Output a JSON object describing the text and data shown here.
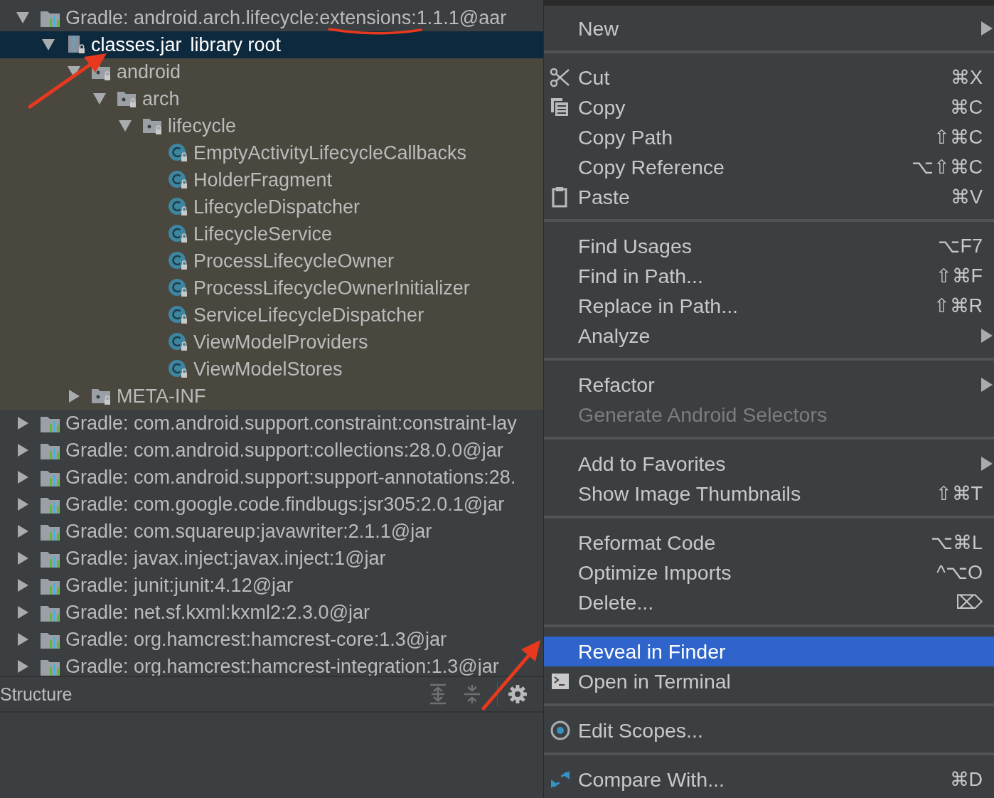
{
  "project_tree": {
    "nodes": [
      {
        "kind": "library",
        "label": "Gradle: android.arch.lifecycle:extensions:1.1.1@aar",
        "expanded": true,
        "selected": false,
        "children": [
          {
            "kind": "jar",
            "label": "classes.jar",
            "note": "library root",
            "expanded": true,
            "selected": true,
            "children": [
              {
                "kind": "package",
                "label": "android",
                "expanded": true,
                "selected": false,
                "children": [
                  {
                    "kind": "package",
                    "label": "arch",
                    "expanded": true,
                    "selected": false,
                    "children": [
                      {
                        "kind": "package",
                        "label": "lifecycle",
                        "expanded": true,
                        "selected": false,
                        "children": [
                          {
                            "kind": "class",
                            "label": "EmptyActivityLifecycleCallbacks",
                            "selected": false
                          },
                          {
                            "kind": "class",
                            "label": "HolderFragment",
                            "selected": false
                          },
                          {
                            "kind": "class",
                            "label": "LifecycleDispatcher",
                            "selected": false
                          },
                          {
                            "kind": "class",
                            "label": "LifecycleService",
                            "selected": false
                          },
                          {
                            "kind": "class",
                            "label": "ProcessLifecycleOwner",
                            "selected": false
                          },
                          {
                            "kind": "class",
                            "label": "ProcessLifecycleOwnerInitializer",
                            "selected": false
                          },
                          {
                            "kind": "class",
                            "label": "ServiceLifecycleDispatcher",
                            "selected": false
                          },
                          {
                            "kind": "class",
                            "label": "ViewModelProviders",
                            "selected": false
                          },
                          {
                            "kind": "class",
                            "label": "ViewModelStores",
                            "selected": false
                          }
                        ]
                      }
                    ]
                  }
                ]
              },
              {
                "kind": "package",
                "label": "META-INF",
                "expanded": false,
                "selected": false
              }
            ]
          }
        ]
      },
      {
        "kind": "library",
        "label": "Gradle: com.android.support.constraint:constraint-lay",
        "expanded": false,
        "selected": false
      },
      {
        "kind": "library",
        "label": "Gradle: com.android.support:collections:28.0.0@jar",
        "expanded": false,
        "selected": false
      },
      {
        "kind": "library",
        "label": "Gradle: com.android.support:support-annotations:28.",
        "expanded": false,
        "selected": false
      },
      {
        "kind": "library",
        "label": "Gradle: com.google.code.findbugs:jsr305:2.0.1@jar",
        "expanded": false,
        "selected": false
      },
      {
        "kind": "library",
        "label": "Gradle: com.squareup:javawriter:2.1.1@jar",
        "expanded": false,
        "selected": false
      },
      {
        "kind": "library",
        "label": "Gradle: javax.inject:javax.inject:1@jar",
        "expanded": false,
        "selected": false
      },
      {
        "kind": "library",
        "label": "Gradle: junit:junit:4.12@jar",
        "expanded": false,
        "selected": false
      },
      {
        "kind": "library",
        "label": "Gradle: net.sf.kxml:kxml2:2.3.0@jar",
        "expanded": false,
        "selected": false
      },
      {
        "kind": "library",
        "label": "Gradle: org.hamcrest:hamcrest-core:1.3@jar",
        "expanded": false,
        "selected": false
      },
      {
        "kind": "library",
        "label": "Gradle: org.hamcrest:hamcrest-integration:1.3@jar",
        "expanded": false,
        "selected": false
      }
    ]
  },
  "structure_bar": {
    "title": "Structure"
  },
  "context_menu": {
    "groups": [
      {
        "items": [
          {
            "kind": "plain",
            "label": "New",
            "submenu": true,
            "disabled": false,
            "selected": false
          }
        ]
      },
      {
        "items": [
          {
            "kind": "cut",
            "label": "Cut",
            "shortcut": "⌘X",
            "submenu": false,
            "disabled": false,
            "selected": false
          },
          {
            "kind": "copy",
            "label": "Copy",
            "shortcut": "⌘C",
            "submenu": false,
            "disabled": false,
            "selected": false
          },
          {
            "kind": "plain",
            "label": "Copy Path",
            "shortcut": "⇧⌘C",
            "submenu": false,
            "disabled": false,
            "selected": false
          },
          {
            "kind": "plain",
            "label": "Copy Reference",
            "shortcut": "⌥⇧⌘C",
            "submenu": false,
            "disabled": false,
            "selected": false
          },
          {
            "kind": "paste",
            "label": "Paste",
            "shortcut": "⌘V",
            "submenu": false,
            "disabled": false,
            "selected": false
          }
        ]
      },
      {
        "items": [
          {
            "kind": "plain",
            "label": "Find Usages",
            "shortcut": "⌥F7",
            "submenu": false,
            "disabled": false,
            "selected": false
          },
          {
            "kind": "plain",
            "label": "Find in Path...",
            "shortcut": "⇧⌘F",
            "submenu": false,
            "disabled": false,
            "selected": false
          },
          {
            "kind": "plain",
            "label": "Replace in Path...",
            "shortcut": "⇧⌘R",
            "submenu": false,
            "disabled": false,
            "selected": false
          },
          {
            "kind": "plain",
            "label": "Analyze",
            "submenu": true,
            "disabled": false,
            "selected": false
          }
        ]
      },
      {
        "items": [
          {
            "kind": "plain",
            "label": "Refactor",
            "submenu": true,
            "disabled": false,
            "selected": false
          },
          {
            "kind": "plain",
            "label": "Generate Android Selectors",
            "submenu": false,
            "disabled": true,
            "selected": false
          }
        ]
      },
      {
        "items": [
          {
            "kind": "plain",
            "label": "Add to Favorites",
            "submenu": true,
            "disabled": false,
            "selected": false
          },
          {
            "kind": "plain",
            "label": "Show Image Thumbnails",
            "shortcut": "⇧⌘T",
            "submenu": false,
            "disabled": false,
            "selected": false
          }
        ]
      },
      {
        "items": [
          {
            "kind": "plain",
            "label": "Reformat Code",
            "shortcut": "⌥⌘L",
            "submenu": false,
            "disabled": false,
            "selected": false
          },
          {
            "kind": "plain",
            "label": "Optimize Imports",
            "shortcut": "^⌥O",
            "submenu": false,
            "disabled": false,
            "selected": false
          },
          {
            "kind": "plain",
            "label": "Delete...",
            "shortcut": "⌦",
            "submenu": false,
            "disabled": false,
            "selected": false
          }
        ]
      },
      {
        "items": [
          {
            "kind": "plain",
            "label": "Reveal in Finder",
            "submenu": false,
            "disabled": false,
            "selected": true
          },
          {
            "kind": "terminal",
            "label": "Open in Terminal",
            "submenu": false,
            "disabled": false,
            "selected": false
          }
        ]
      },
      {
        "items": [
          {
            "kind": "scopes",
            "label": "Edit Scopes...",
            "submenu": false,
            "disabled": false,
            "selected": false
          }
        ]
      },
      {
        "items": [
          {
            "kind": "compare",
            "label": "Compare With...",
            "shortcut": "⌘D",
            "submenu": false,
            "disabled": false,
            "selected": false
          }
        ]
      }
    ]
  }
}
